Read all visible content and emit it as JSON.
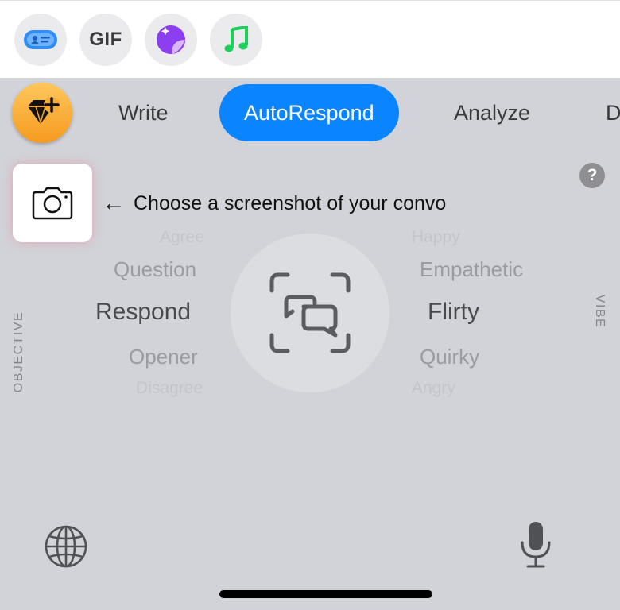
{
  "app_strip": {
    "items": [
      {
        "icon": "contact-card-icon",
        "color": "#2f8df5"
      },
      {
        "icon": "gif-icon",
        "label": "GIF"
      },
      {
        "icon": "sticker-icon",
        "color": "#8b3ff0"
      },
      {
        "icon": "music-note-icon",
        "color": "#1ccf5a"
      }
    ]
  },
  "toolbar": {
    "premium_icon": "gem-plus-icon",
    "tabs": [
      {
        "label": "Write",
        "active": false
      },
      {
        "label": "AutoRespond",
        "active": true
      },
      {
        "label": "Analyze",
        "active": false
      },
      {
        "label": "D",
        "active": false
      }
    ],
    "accent": "#0a84ff"
  },
  "screenshot_picker": {
    "icon": "camera-icon",
    "hint": "Choose a screenshot of your convo",
    "hint_arrow": "←"
  },
  "help": {
    "label": "?"
  },
  "objective": {
    "title": "OBJECTIVE",
    "options": [
      "Agree",
      "Question",
      "Respond",
      "Opener",
      "Disagree"
    ],
    "selected": "Respond"
  },
  "vibe": {
    "title": "VIBE",
    "options": [
      "Happy",
      "Empathetic",
      "Flirty",
      "Quirky",
      "Angry"
    ],
    "selected": "Flirty"
  },
  "center": {
    "icon": "scan-chat-icon"
  },
  "bottom": {
    "left_icon": "globe-icon",
    "right_icon": "microphone-icon"
  }
}
